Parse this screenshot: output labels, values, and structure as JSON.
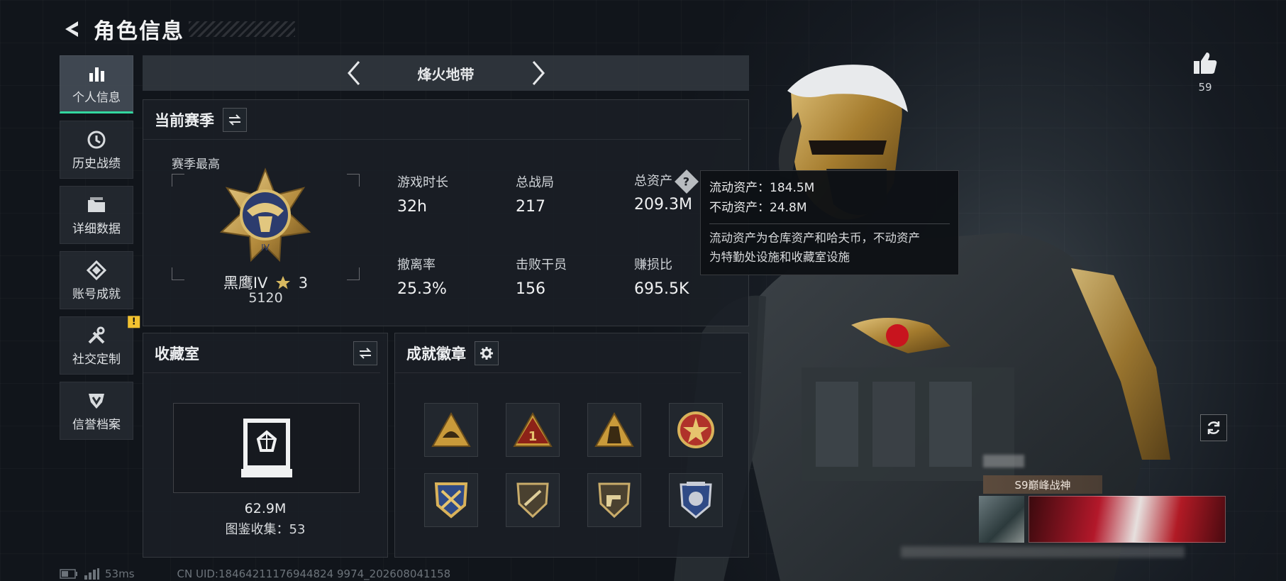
{
  "header": {
    "title": "角色信息"
  },
  "sidebar": {
    "items": [
      {
        "label": "个人信息",
        "icon": "bar-chart-icon",
        "active": true
      },
      {
        "label": "历史战绩",
        "icon": "history-icon"
      },
      {
        "label": "详细数据",
        "icon": "folder-icon"
      },
      {
        "label": "账号成就",
        "icon": "achievement-icon"
      },
      {
        "label": "社交定制",
        "icon": "tools-icon",
        "badge": "!"
      },
      {
        "label": "信誉档案",
        "icon": "shield-icon"
      }
    ]
  },
  "map_selector": {
    "name": "烽火地带"
  },
  "season": {
    "title": "当前赛季",
    "best_label": "赛季最高",
    "rank_name": "黑鹰IV",
    "rank_stars": "3",
    "rank_score": "5120",
    "stats": [
      {
        "label": "游戏时长",
        "value": "32h"
      },
      {
        "label": "总战局",
        "value": "217"
      },
      {
        "label": "总资产",
        "value": "209.3M"
      },
      {
        "label": "撤离率",
        "value": "25.3%"
      },
      {
        "label": "击败干员",
        "value": "156"
      },
      {
        "label": "赚损比",
        "value": "695.5K"
      }
    ]
  },
  "tooltip": {
    "liquid": "流动资产：184.5M",
    "fixed": "不动资产：24.8M",
    "desc_line1": "流动资产为仓库资产和哈夫币，不动资产",
    "desc_line2": "为特勤处设施和收藏室设施"
  },
  "collection": {
    "title": "收藏室",
    "value": "62.9M",
    "count": "图鉴收集：53"
  },
  "badges": {
    "title": "成就徽章"
  },
  "like": {
    "count": "59"
  },
  "player_card": {
    "title": "S9巅峰战神"
  },
  "footer": {
    "ping": "53ms",
    "uid": "CN UID:18464211176944824 9974_202608041158"
  },
  "colors": {
    "accent": "#33d69f",
    "badge_gold": "#c99a3a",
    "alert": "#f2c230"
  }
}
